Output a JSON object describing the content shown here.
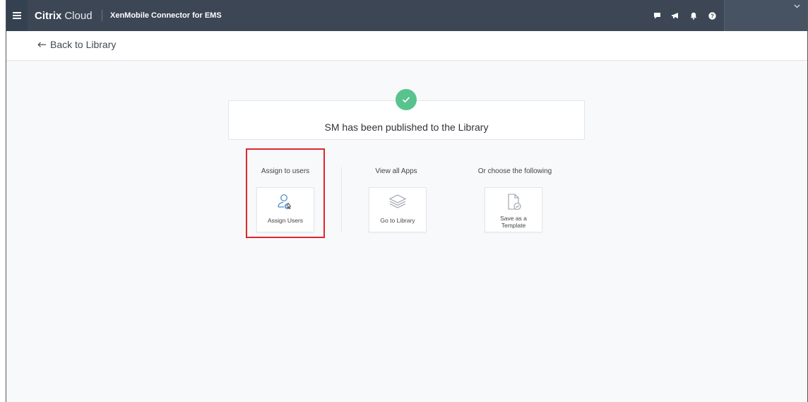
{
  "topbar": {
    "brand_bold": "Citrix",
    "brand_light": "Cloud",
    "product": "XenMobile Connector for EMS",
    "icons": [
      "chat-icon",
      "megaphone-icon",
      "bell-icon",
      "help-icon"
    ]
  },
  "nav": {
    "back_label": "Back to Library"
  },
  "banner": {
    "message": "SM has been published to the Library"
  },
  "options": [
    {
      "heading": "Assign to users",
      "card_label": "Assign Users",
      "icon": "assign-users-icon"
    },
    {
      "heading": "View all Apps",
      "card_label": "Go to Library",
      "icon": "layers-icon"
    },
    {
      "heading": "Or choose the following",
      "card_label_1": "Save as a",
      "card_label_2": "Template",
      "icon": "document-check-icon"
    }
  ],
  "colors": {
    "topbar": "#3c4655",
    "success": "#59c38e",
    "highlight": "#e0262c",
    "background": "#f8f9fb"
  }
}
